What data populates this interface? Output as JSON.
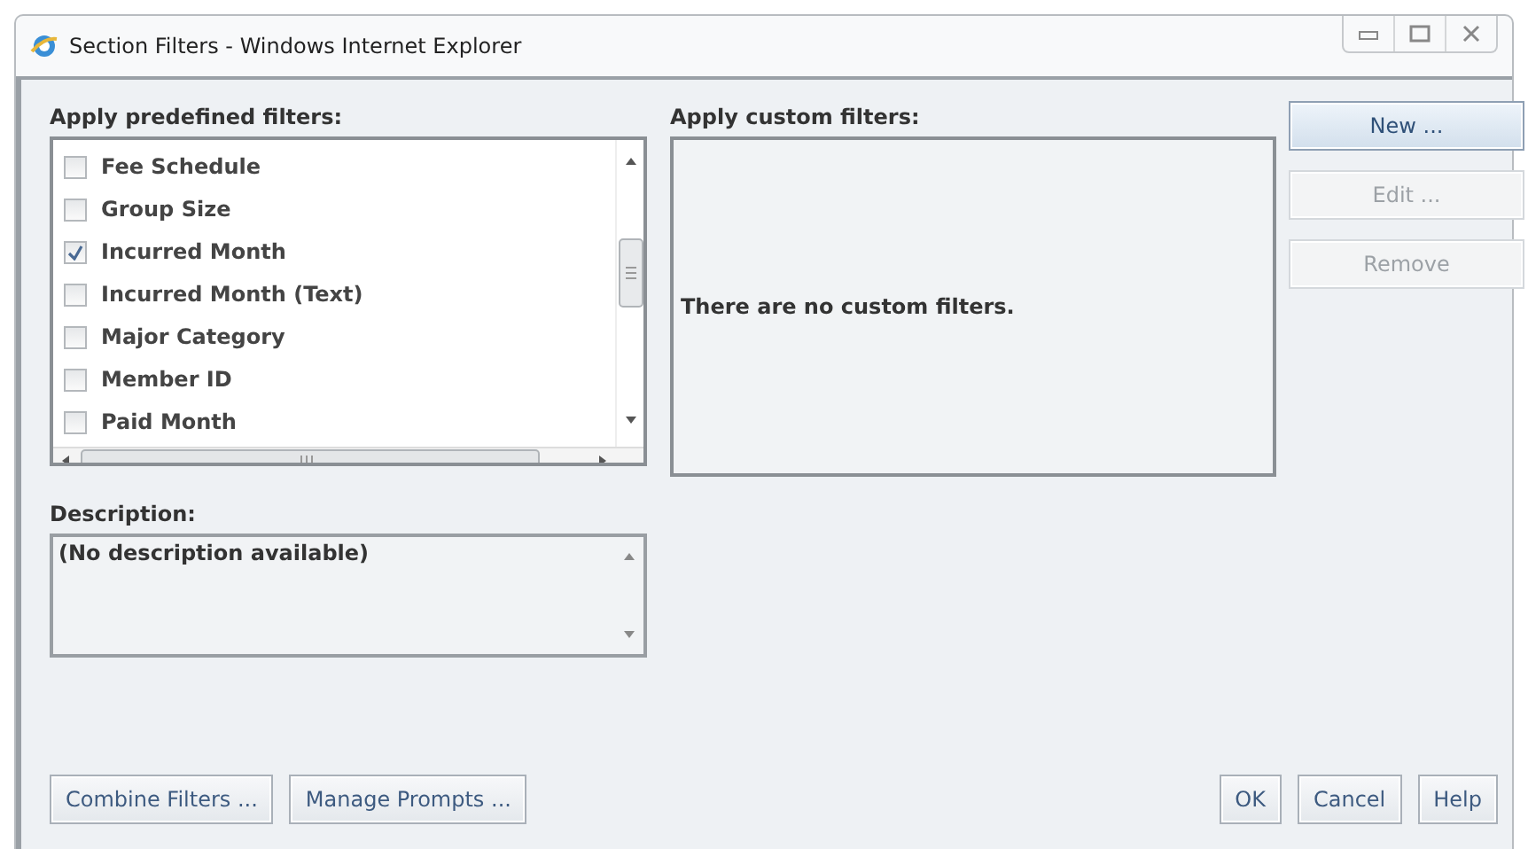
{
  "window": {
    "title": "Section Filters - Windows Internet Explorer"
  },
  "predefined_filters": {
    "label": "Apply predefined filters:",
    "items": [
      {
        "label": "Fee Schedule",
        "checked": false
      },
      {
        "label": "Group Size",
        "checked": false
      },
      {
        "label": "Incurred Month",
        "checked": true
      },
      {
        "label": "Incurred Month (Text)",
        "checked": false
      },
      {
        "label": "Major Category",
        "checked": false
      },
      {
        "label": "Member ID",
        "checked": false
      },
      {
        "label": "Paid Month",
        "checked": false
      }
    ]
  },
  "custom_filters": {
    "label": "Apply custom filters:",
    "empty_message": "There are no custom filters."
  },
  "side_buttons": [
    {
      "label": "New ...",
      "disabled": false,
      "default": true
    },
    {
      "label": "Edit ...",
      "disabled": true,
      "default": false
    },
    {
      "label": "Remove",
      "disabled": true,
      "default": false
    }
  ],
  "description": {
    "label": "Description:",
    "value": "(No description available)"
  },
  "footer_buttons_left": [
    {
      "label": "Combine Filters ..."
    },
    {
      "label": "Manage Prompts ..."
    }
  ],
  "footer_buttons_right": [
    {
      "label": "OK"
    },
    {
      "label": "Cancel"
    },
    {
      "label": "Help"
    }
  ]
}
